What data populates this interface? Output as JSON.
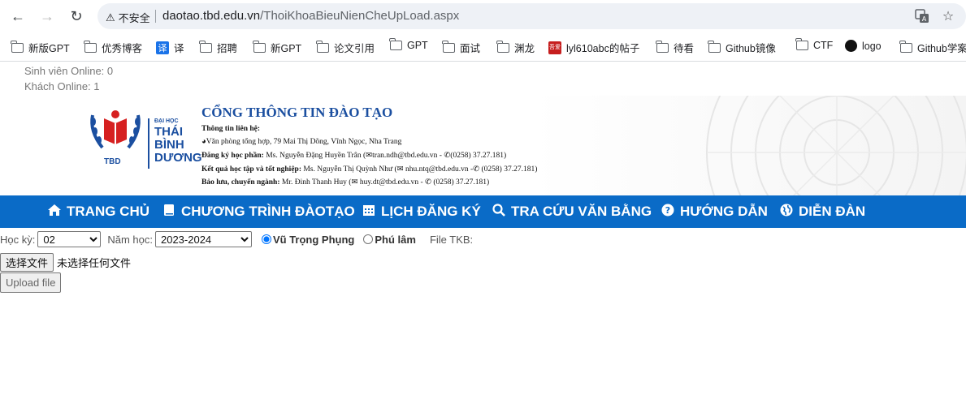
{
  "browser": {
    "security_label": "不安全",
    "url_host": "daotao.tbd.edu.vn",
    "url_path": "/ThoiKhoaBieuNienCheUpLoad.aspx"
  },
  "bookmarks": [
    {
      "label": "新版GPT",
      "icon": "folder-icon"
    },
    {
      "label": "优秀博客",
      "icon": "folder-icon"
    },
    {
      "label": "译",
      "icon": "translate-icon"
    },
    {
      "label": "招聘",
      "icon": "folder-icon"
    },
    {
      "label": "新GPT",
      "icon": "folder-icon"
    },
    {
      "label": "论文引用",
      "icon": "folder-icon"
    },
    {
      "label": "GPT",
      "icon": "folder-icon"
    },
    {
      "label": "面试",
      "icon": "folder-icon"
    },
    {
      "label": "渊龙",
      "icon": "folder-icon"
    },
    {
      "label": "lyl610abc的帖子",
      "icon": "site-icon"
    },
    {
      "label": "待看",
      "icon": "folder-icon"
    },
    {
      "label": "Github镜像",
      "icon": "folder-icon"
    },
    {
      "label": "CTF",
      "icon": "folder-icon"
    },
    {
      "label": "logo",
      "icon": "apple-icon"
    },
    {
      "label": "Github学案",
      "icon": "folder-icon"
    }
  ],
  "online": {
    "students": "Sinh viên Online: 0",
    "guests": "Khách Online: 1"
  },
  "header": {
    "logo_small": "ĐẠI HỌC",
    "logo_line1": "THÁI",
    "logo_line2": "BÌNH",
    "logo_line3": "DƯƠNG",
    "logo_tbd": "TBD",
    "portal_title": "CỔNG THÔNG TIN ĐÀO TẠO",
    "contact_heading": "Thông tin liên hệ:",
    "address": "Văn phòng tổng hợp, 79 Mai Thị Dõng, Vĩnh Ngọc, Nha Trang",
    "reg_label": "Đăng ký học phần:",
    "reg_person": " Ms. Nguyễn Đặng Huyền Trân (",
    "reg_email": "tran.ndh@tbd.edu.vn - ",
    "reg_phone": "(0258) 37.27.181)",
    "result_label": "Kết quả học tập và tốt nghiệp:",
    "result_person": " Ms. Nguyễn Thị Quỳnh Như (",
    "result_email": " nhu.ntq@tbd.edu.vn -",
    "result_phone": " (0258) 37.27.181)",
    "reserve_label": "Bảo lưu, chuyển ngành:",
    "reserve_person": " Mr. Đinh Thanh Huy (",
    "reserve_email": " huy.dt@tbd.edu.vn - ",
    "reserve_phone": " (0258) 37.27.181)"
  },
  "nav": [
    {
      "label": "TRANG CHỦ",
      "icon": "home-icon"
    },
    {
      "label": "CHƯƠNG TRÌNH ĐÀOTẠO",
      "icon": "book-icon"
    },
    {
      "label": "LỊCH ĐĂNG KÝ",
      "icon": "calendar-icon"
    },
    {
      "label": "TRA CỨU VĂN BẰNG",
      "icon": "search-icon"
    },
    {
      "label": "HƯỚNG DẪN",
      "icon": "question-icon"
    },
    {
      "label": "DIỄN ĐÀN",
      "icon": "globe-icon"
    }
  ],
  "form": {
    "semester_label": "Học kỳ:",
    "semester_value": "02",
    "year_label": "Năm học:",
    "year_value": "2023-2024",
    "campus1": "Vũ Trọng Phụng",
    "campus2": "Phú lâm",
    "file_label": "File TKB:",
    "choose_file": "选择文件",
    "no_file": "未选择任何文件",
    "upload": "Upload file"
  }
}
